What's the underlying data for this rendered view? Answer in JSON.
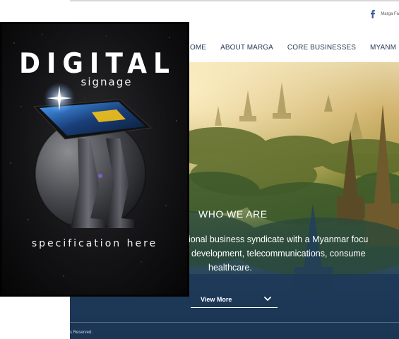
{
  "site": {
    "social": {
      "icon": "facebook-icon",
      "label": "Marga Fa"
    },
    "nav": [
      "OME",
      "ABOUT MARGA",
      "CORE BUSINESSES",
      "MYANM"
    ],
    "hero": {
      "title": "WHO WE ARE",
      "lines": [
        "ional business syndicate with a Myanmar focu",
        "development, telecommunications, consume",
        "healthcare."
      ],
      "cta_label": "View More",
      "cta_icon": "chevron-down-icon"
    },
    "footer": {
      "copyright": "s Reserved."
    }
  },
  "poster": {
    "title": "DIGITAL",
    "subtitle": "signage",
    "caption": "specification here",
    "illustration": "digital-signage-kiosk-on-planet"
  },
  "colors": {
    "nav_text": "#2a3a55",
    "hero_top": "#e6d4a4",
    "hero_bottom": "#1a3453",
    "facebook": "#3b5998",
    "poster_bg": "#131315"
  }
}
